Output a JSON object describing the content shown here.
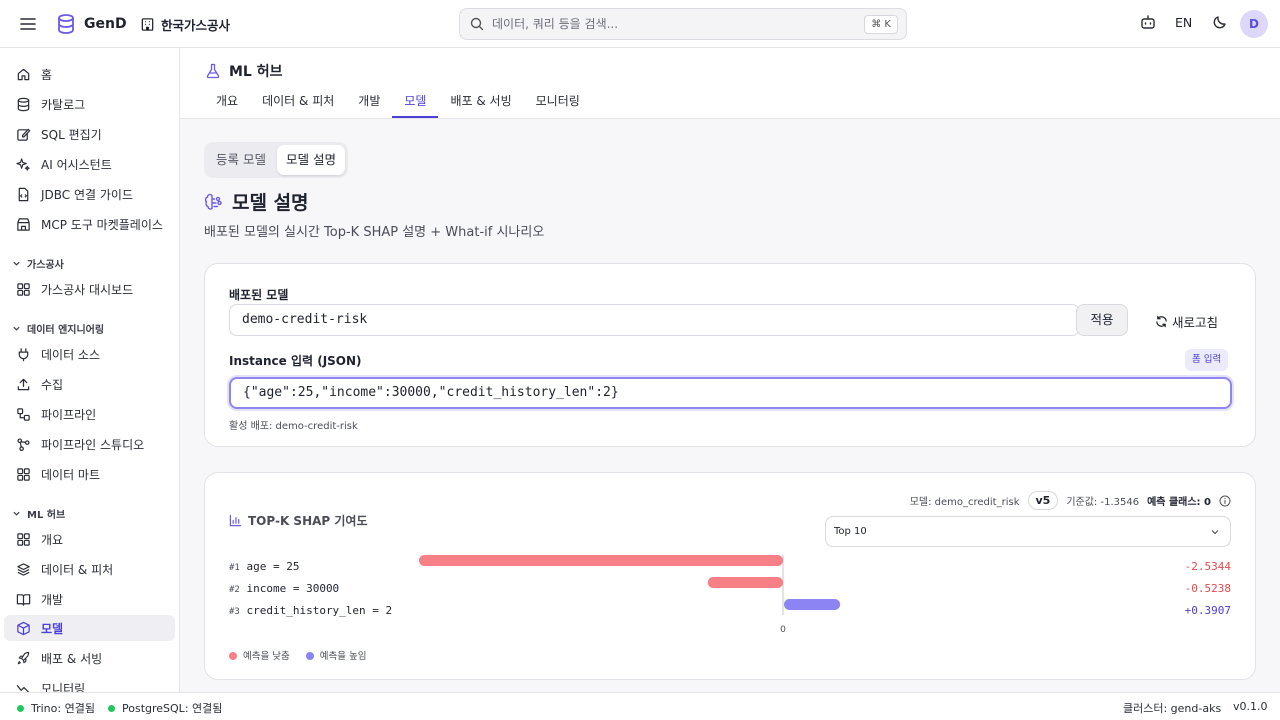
{
  "app": {
    "name": "GenD",
    "org": "한국가스공사"
  },
  "search": {
    "placeholder": "데이터, 쿼리 등을 검색...",
    "shortcut": "⌘ K"
  },
  "topbar": {
    "lang": "EN",
    "avatar_initial": "D"
  },
  "sidebar": {
    "top_items": [
      {
        "label": "홈",
        "icon": "home-icon"
      },
      {
        "label": "카탈로그",
        "icon": "database-icon"
      },
      {
        "label": "SQL 편집기",
        "icon": "edit-icon"
      },
      {
        "label": "AI 어시스턴트",
        "icon": "sparkle-icon"
      },
      {
        "label": "JDBC 연결 가이드",
        "icon": "file-code-icon"
      },
      {
        "label": "MCP 도구 마켓플레이스",
        "icon": "store-icon"
      }
    ],
    "section_gas": {
      "title": "가스공사",
      "items": [
        {
          "label": "가스공사 대시보드",
          "icon": "grid-icon"
        }
      ]
    },
    "section_de": {
      "title": "데이터 엔지니어링",
      "items": [
        {
          "label": "데이터 소스",
          "icon": "plug-icon"
        },
        {
          "label": "수집",
          "icon": "upload-icon"
        },
        {
          "label": "파이프라인",
          "icon": "workflow-icon"
        },
        {
          "label": "파이프라인 스튜디오",
          "icon": "git-branch-icon"
        },
        {
          "label": "데이터 마트",
          "icon": "grid-icon"
        }
      ]
    },
    "section_ml": {
      "title": "ML 허브",
      "items": [
        {
          "label": "개요",
          "icon": "grid-icon"
        },
        {
          "label": "데이터 & 피처",
          "icon": "layers-icon"
        },
        {
          "label": "개발",
          "icon": "book-icon"
        },
        {
          "label": "모델",
          "icon": "cube-icon",
          "active": true
        },
        {
          "label": "배포 & 서빙",
          "icon": "rocket-icon"
        },
        {
          "label": "모니터링",
          "icon": "activity-icon"
        }
      ]
    }
  },
  "header": {
    "title": "ML 허브",
    "tabs": [
      "개요",
      "데이터 & 피처",
      "개발",
      "모델",
      "배포 & 서빙",
      "모니터링"
    ],
    "active_tab": "모델"
  },
  "segment": {
    "items": [
      "등록 모델",
      "모델 설명"
    ],
    "active": "모델 설명"
  },
  "page": {
    "title": "모델 설명",
    "subtitle": "배포된 모델의 실시간 Top-K SHAP 설명 + What-if 시나리오"
  },
  "form": {
    "model_label": "배포된 모델",
    "model_value": "demo-credit-risk",
    "apply_label": "적용",
    "refresh_label": "새로고침",
    "instance_label": "Instance 입력 (JSON)",
    "form_input_label": "폼 입력",
    "instance_value": "{\"age\":25,\"income\":30000,\"credit_history_len\":2}",
    "active_hint": "활성 배포: demo-credit-risk"
  },
  "shap": {
    "title": "TOP-K SHAP 기여도",
    "model_meta": "모델: demo_credit_risk",
    "version": "v5",
    "baseline": "기준값: -1.3546",
    "predicted_class": "예측 클래스: 0",
    "topk_select": "Top 10",
    "zero_label": "0",
    "legend_neg": "예측을 낮춤",
    "legend_pos": "예측을 높임"
  },
  "chart_data": {
    "type": "bar",
    "orientation": "horizontal",
    "title": "TOP-K SHAP 기여도",
    "categories": [
      "age = 25",
      "income = 30000",
      "credit_history_len = 2"
    ],
    "ranks": [
      "#1",
      "#2",
      "#3"
    ],
    "features": [
      "age",
      "income",
      "credit_history_len"
    ],
    "feature_values": [
      "25",
      "30000",
      "2"
    ],
    "values": [
      -2.5344,
      -0.5238,
      0.3907
    ],
    "value_labels": [
      "-2.5344",
      "-0.5238",
      "+0.3907"
    ],
    "xlim": [
      -2.5344,
      2.5344
    ],
    "colors": {
      "negative": "#f77f86",
      "positive": "#8b84f2"
    }
  },
  "status": {
    "trino": "Trino: 연결됨",
    "postgres": "PostgreSQL: 연결됨",
    "cluster": "클러스터: gend-aks",
    "version": "v0.1.0"
  },
  "colors": {
    "accent": "#4b3fd8",
    "status_ok": "#22c55e"
  }
}
